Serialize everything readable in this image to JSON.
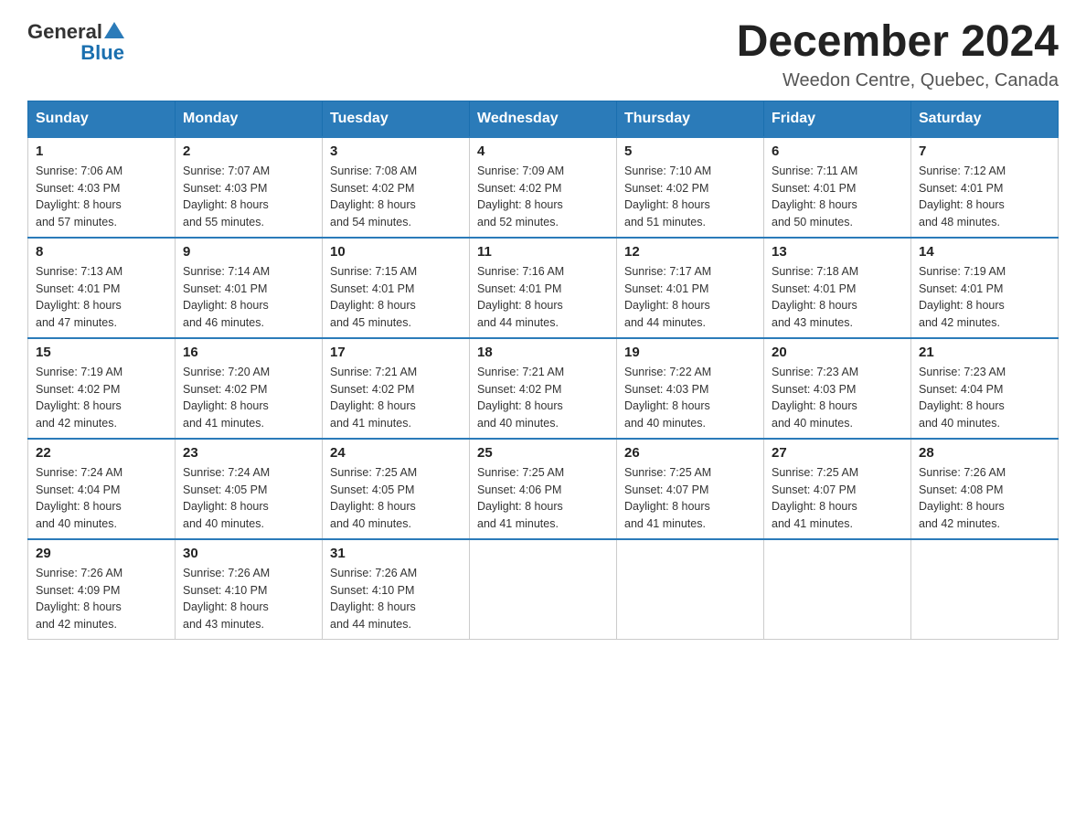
{
  "header": {
    "logo_general": "General",
    "logo_blue": "Blue",
    "month_title": "December 2024",
    "location": "Weedon Centre, Quebec, Canada"
  },
  "weekdays": [
    "Sunday",
    "Monday",
    "Tuesday",
    "Wednesday",
    "Thursday",
    "Friday",
    "Saturday"
  ],
  "weeks": [
    [
      {
        "day": "1",
        "sunrise": "7:06 AM",
        "sunset": "4:03 PM",
        "daylight": "8 hours and 57 minutes."
      },
      {
        "day": "2",
        "sunrise": "7:07 AM",
        "sunset": "4:03 PM",
        "daylight": "8 hours and 55 minutes."
      },
      {
        "day": "3",
        "sunrise": "7:08 AM",
        "sunset": "4:02 PM",
        "daylight": "8 hours and 54 minutes."
      },
      {
        "day": "4",
        "sunrise": "7:09 AM",
        "sunset": "4:02 PM",
        "daylight": "8 hours and 52 minutes."
      },
      {
        "day": "5",
        "sunrise": "7:10 AM",
        "sunset": "4:02 PM",
        "daylight": "8 hours and 51 minutes."
      },
      {
        "day": "6",
        "sunrise": "7:11 AM",
        "sunset": "4:01 PM",
        "daylight": "8 hours and 50 minutes."
      },
      {
        "day": "7",
        "sunrise": "7:12 AM",
        "sunset": "4:01 PM",
        "daylight": "8 hours and 48 minutes."
      }
    ],
    [
      {
        "day": "8",
        "sunrise": "7:13 AM",
        "sunset": "4:01 PM",
        "daylight": "8 hours and 47 minutes."
      },
      {
        "day": "9",
        "sunrise": "7:14 AM",
        "sunset": "4:01 PM",
        "daylight": "8 hours and 46 minutes."
      },
      {
        "day": "10",
        "sunrise": "7:15 AM",
        "sunset": "4:01 PM",
        "daylight": "8 hours and 45 minutes."
      },
      {
        "day": "11",
        "sunrise": "7:16 AM",
        "sunset": "4:01 PM",
        "daylight": "8 hours and 44 minutes."
      },
      {
        "day": "12",
        "sunrise": "7:17 AM",
        "sunset": "4:01 PM",
        "daylight": "8 hours and 44 minutes."
      },
      {
        "day": "13",
        "sunrise": "7:18 AM",
        "sunset": "4:01 PM",
        "daylight": "8 hours and 43 minutes."
      },
      {
        "day": "14",
        "sunrise": "7:19 AM",
        "sunset": "4:01 PM",
        "daylight": "8 hours and 42 minutes."
      }
    ],
    [
      {
        "day": "15",
        "sunrise": "7:19 AM",
        "sunset": "4:02 PM",
        "daylight": "8 hours and 42 minutes."
      },
      {
        "day": "16",
        "sunrise": "7:20 AM",
        "sunset": "4:02 PM",
        "daylight": "8 hours and 41 minutes."
      },
      {
        "day": "17",
        "sunrise": "7:21 AM",
        "sunset": "4:02 PM",
        "daylight": "8 hours and 41 minutes."
      },
      {
        "day": "18",
        "sunrise": "7:21 AM",
        "sunset": "4:02 PM",
        "daylight": "8 hours and 40 minutes."
      },
      {
        "day": "19",
        "sunrise": "7:22 AM",
        "sunset": "4:03 PM",
        "daylight": "8 hours and 40 minutes."
      },
      {
        "day": "20",
        "sunrise": "7:23 AM",
        "sunset": "4:03 PM",
        "daylight": "8 hours and 40 minutes."
      },
      {
        "day": "21",
        "sunrise": "7:23 AM",
        "sunset": "4:04 PM",
        "daylight": "8 hours and 40 minutes."
      }
    ],
    [
      {
        "day": "22",
        "sunrise": "7:24 AM",
        "sunset": "4:04 PM",
        "daylight": "8 hours and 40 minutes."
      },
      {
        "day": "23",
        "sunrise": "7:24 AM",
        "sunset": "4:05 PM",
        "daylight": "8 hours and 40 minutes."
      },
      {
        "day": "24",
        "sunrise": "7:25 AM",
        "sunset": "4:05 PM",
        "daylight": "8 hours and 40 minutes."
      },
      {
        "day": "25",
        "sunrise": "7:25 AM",
        "sunset": "4:06 PM",
        "daylight": "8 hours and 41 minutes."
      },
      {
        "day": "26",
        "sunrise": "7:25 AM",
        "sunset": "4:07 PM",
        "daylight": "8 hours and 41 minutes."
      },
      {
        "day": "27",
        "sunrise": "7:25 AM",
        "sunset": "4:07 PM",
        "daylight": "8 hours and 41 minutes."
      },
      {
        "day": "28",
        "sunrise": "7:26 AM",
        "sunset": "4:08 PM",
        "daylight": "8 hours and 42 minutes."
      }
    ],
    [
      {
        "day": "29",
        "sunrise": "7:26 AM",
        "sunset": "4:09 PM",
        "daylight": "8 hours and 42 minutes."
      },
      {
        "day": "30",
        "sunrise": "7:26 AM",
        "sunset": "4:10 PM",
        "daylight": "8 hours and 43 minutes."
      },
      {
        "day": "31",
        "sunrise": "7:26 AM",
        "sunset": "4:10 PM",
        "daylight": "8 hours and 44 minutes."
      },
      null,
      null,
      null,
      null
    ]
  ]
}
